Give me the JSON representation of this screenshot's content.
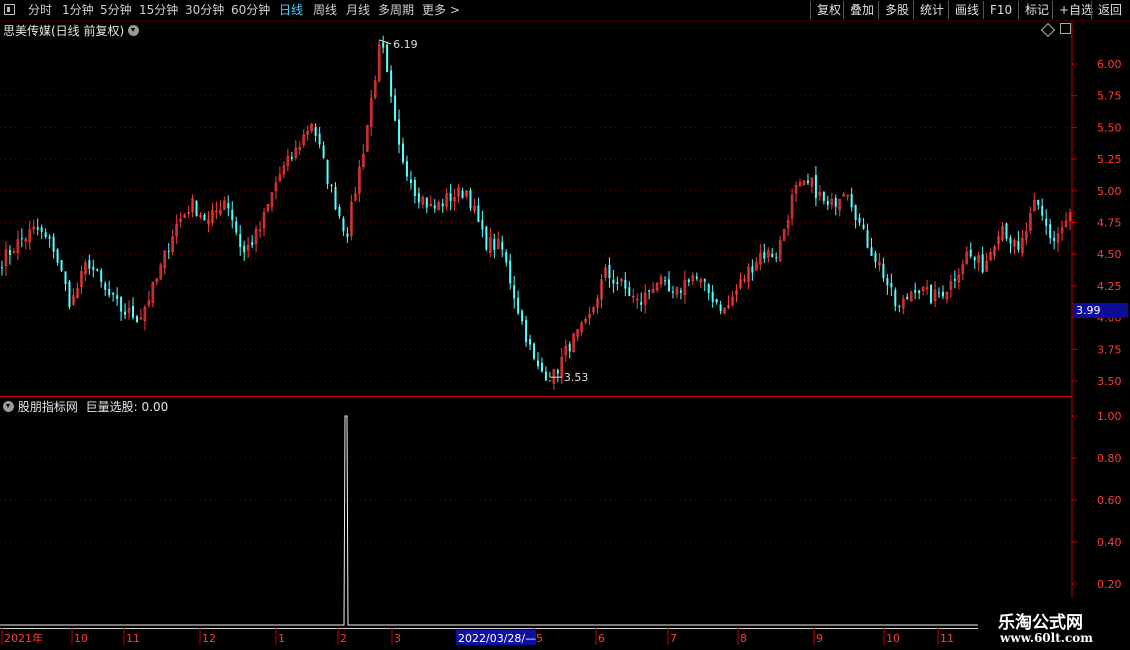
{
  "toolbar": {
    "periods": [
      "分时",
      "1分钟",
      "5分钟",
      "15分钟",
      "30分钟",
      "60分钟",
      "日线",
      "周线",
      "月线",
      "多周期",
      "更多 >"
    ],
    "active_period": "日线",
    "right_buttons": [
      "复权",
      "叠加",
      "多股",
      "统计",
      "画线",
      "F10",
      "标记",
      "+自选",
      "返回"
    ]
  },
  "main_chart": {
    "title": "思美传媒(日线 前复权)",
    "current_price_tag": "3.99",
    "high_marker": "6.19",
    "low_marker": "3.53",
    "y_ticks": [
      "6.00",
      "5.75",
      "5.50",
      "5.25",
      "5.00",
      "4.75",
      "4.50",
      "4.25",
      "4.00",
      "3.75",
      "3.50"
    ]
  },
  "indicator": {
    "title": "股朋指标网",
    "line_label": "巨量选股: 0.00",
    "y_ticks": [
      "1.00",
      "0.80",
      "0.60",
      "0.40",
      "0.20"
    ]
  },
  "time_axis": {
    "labels": [
      "2021年",
      "10",
      "11",
      "12",
      "1",
      "2",
      "3",
      "5",
      "6",
      "7",
      "8",
      "9",
      "10",
      "11"
    ],
    "cursor_date": "2022/03/28/—"
  },
  "watermark": {
    "title": "乐淘公式网",
    "url": "www.60lt.com"
  },
  "colors": {
    "up": "#ff3c3c",
    "down": "#54ffff",
    "axis": "#cc0000",
    "grid": "#7a0000",
    "active_tab": "#4fd2ff",
    "cursor_bg": "#1010a0"
  },
  "chart_data": {
    "type": "candlestick",
    "title": "思美传媒(日线 前复权)",
    "ylim": [
      3.45,
      6.25
    ],
    "y_ticks": [
      6.0,
      5.75,
      5.5,
      5.25,
      5.0,
      4.75,
      4.5,
      4.25,
      4.0,
      3.75,
      3.5
    ],
    "price_path": [
      4.45,
      4.6,
      4.7,
      4.55,
      4.1,
      4.45,
      4.2,
      4.05,
      4.0,
      4.3,
      4.7,
      4.9,
      4.75,
      4.95,
      4.5,
      4.7,
      5.1,
      5.3,
      5.55,
      5.05,
      4.65,
      5.35,
      6.19,
      5.35,
      5.0,
      4.85,
      4.95,
      5.0,
      4.6,
      4.55,
      4.05,
      3.6,
      3.53,
      3.8,
      3.95,
      4.35,
      4.25,
      4.1,
      4.3,
      4.15,
      4.35,
      4.2,
      4.05,
      4.3,
      4.5,
      4.5,
      5.0,
      5.05,
      4.85,
      5.05,
      4.65,
      4.4,
      4.05,
      4.25,
      4.15,
      4.25,
      4.5,
      4.4,
      4.75,
      4.5,
      4.9,
      4.6,
      4.8
    ],
    "extremes": {
      "high": 6.19,
      "low": 3.53
    },
    "last_price": 3.99,
    "indicator": {
      "name": "巨量选股",
      "ylim": [
        0,
        1.05
      ],
      "y_ticks": [
        1.0,
        0.8,
        0.6,
        0.4,
        0.2
      ],
      "current_value": 0.0,
      "spike_value": 1.0
    }
  }
}
